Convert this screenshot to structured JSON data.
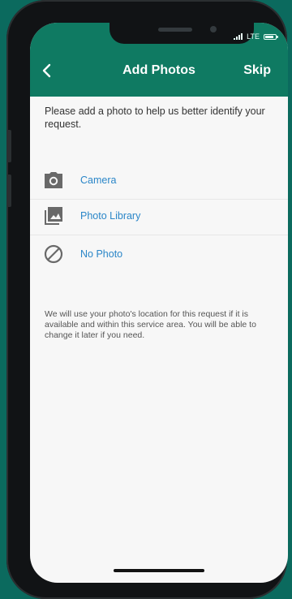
{
  "nav": {
    "title": "Add Photos",
    "skip_label": "Skip"
  },
  "status": {
    "network": "LTE"
  },
  "intro_text": "Please add a photo to help us better identify your request.",
  "options": [
    {
      "label": "Camera",
      "icon": "camera-icon"
    },
    {
      "label": "Photo Library",
      "icon": "photo-library-icon"
    },
    {
      "label": "No Photo",
      "icon": "no-photo-icon"
    }
  ],
  "note_text": "We will use your photo's location for this request if it is available and within this service area.  You will be able to change it later if you need.",
  "colors": {
    "background": "#0b6a5e",
    "header": "#0f7a62",
    "link": "#2a86c8",
    "screen": "#f7f7f7"
  }
}
